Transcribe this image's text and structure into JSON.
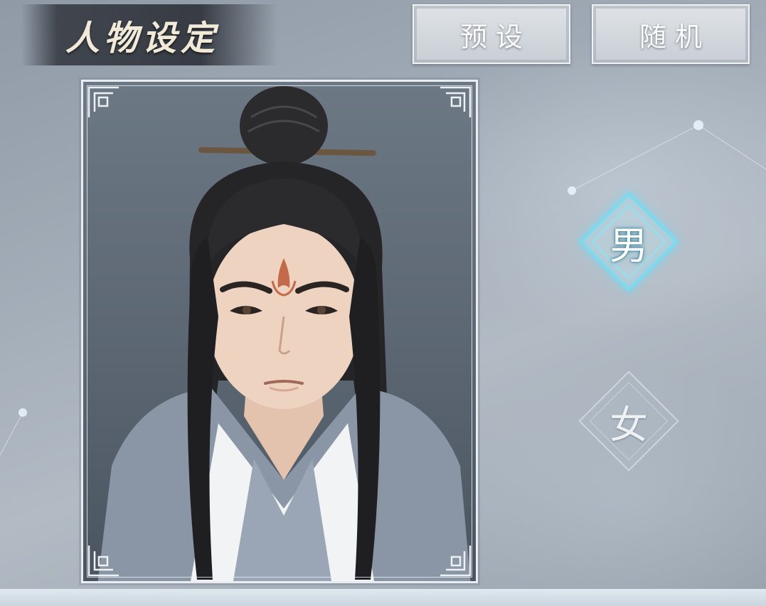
{
  "header": {
    "title": "人物设定"
  },
  "toolbar": {
    "preset_label": "预设",
    "random_label": "随机"
  },
  "gender": {
    "male_label": "男",
    "female_label": "女",
    "selected": "男"
  },
  "colors": {
    "selected_glow": "#7fd9ee",
    "banner": "#32363e",
    "button": "#d3d8dd"
  }
}
